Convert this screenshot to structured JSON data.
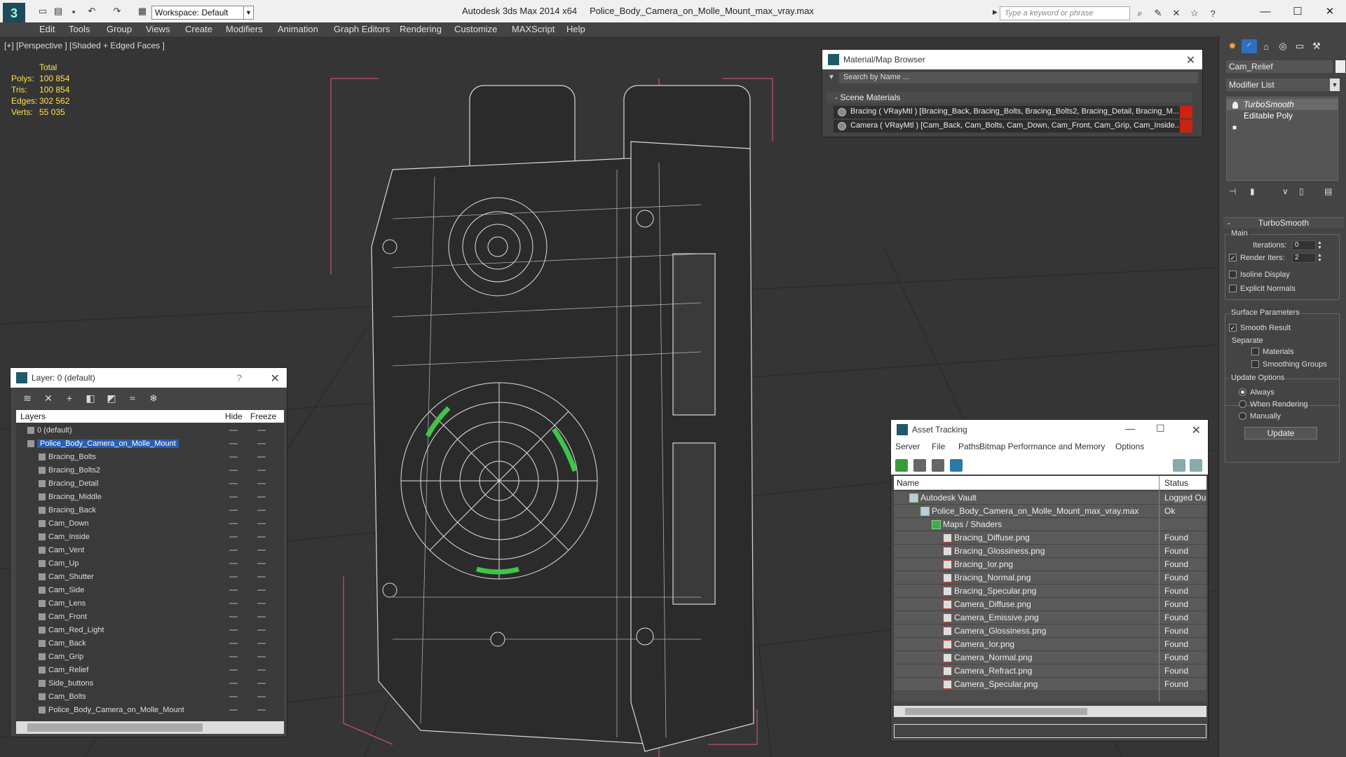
{
  "titlebar": {
    "workspace": "Workspace: Default",
    "app_title": "Autodesk 3ds Max  2014 x64",
    "file_name": "Police_Body_Camera_on_Molle_Mount_max_vray.max",
    "search_placeholder": "Type a keyword or phrase"
  },
  "menu": [
    "Edit",
    "Tools",
    "Group",
    "Views",
    "Create",
    "Modifiers",
    "Animation",
    "Graph Editors",
    "Rendering",
    "Customize",
    "MAXScript",
    "Help"
  ],
  "viewport": {
    "label": "[+] [Perspective ] [Shaded + Edged Faces ]",
    "stats": {
      "header": "Total",
      "rows": [
        {
          "k": "Polys:",
          "v": "100 854"
        },
        {
          "k": "Tris:",
          "v": "100 854"
        },
        {
          "k": "Edges:",
          "v": "302 562"
        },
        {
          "k": "Verts:",
          "v": "55 035"
        }
      ]
    }
  },
  "material_browser": {
    "title": "Material/Map Browser",
    "search": "Search by Name ...",
    "section": "Scene Materials",
    "rows": [
      "Bracing  ( VRayMtl )  [Bracing_Back, Bracing_Bolts, Bracing_Bolts2, Bracing_Detail, Bracing_M...",
      "Camera  ( VRayMtl )  [Cam_Back, Cam_Bolts, Cam_Down, Cam_Front, Cam_Grip, Cam_Inside..."
    ]
  },
  "layers": {
    "title": "Layer: 0 (default)",
    "help": "?",
    "col_layers": "Layers",
    "col_hide": "Hide",
    "col_freeze": "Freeze",
    "items": [
      "0 (default)",
      "Police_Body_Camera_on_Molle_Mount",
      "Bracing_Bolts",
      "Bracing_Bolts2",
      "Bracing_Detail",
      "Bracing_Middle",
      "Bracing_Back",
      "Cam_Down",
      "Cam_Inside",
      "Cam_Vent",
      "Cam_Up",
      "Cam_Shutter",
      "Cam_Side",
      "Cam_Lens",
      "Cam_Front",
      "Cam_Red_Light",
      "Cam_Back",
      "Cam_Grip",
      "Cam_Relief",
      "Side_buttons",
      "Cam_Bolts",
      "Police_Body_Camera_on_Molle_Mount"
    ]
  },
  "asset_tracking": {
    "title": "Asset Tracking",
    "menus": [
      "Server",
      "File",
      "Paths",
      "Bitmap Performance and Memory",
      "Options"
    ],
    "col_name": "Name",
    "col_status": "Status",
    "rows": [
      {
        "name": "Autodesk Vault",
        "status": "Logged Ou"
      },
      {
        "name": "Police_Body_Camera_on_Molle_Mount_max_vray.max",
        "status": "Ok"
      },
      {
        "name": "Maps / Shaders",
        "status": ""
      },
      {
        "name": "Bracing_Diffuse.png",
        "status": "Found"
      },
      {
        "name": "Bracing_Glossiness.png",
        "status": "Found"
      },
      {
        "name": "Bracing_Ior.png",
        "status": "Found"
      },
      {
        "name": "Bracing_Normal.png",
        "status": "Found"
      },
      {
        "name": "Bracing_Specular.png",
        "status": "Found"
      },
      {
        "name": "Camera_Diffuse.png",
        "status": "Found"
      },
      {
        "name": "Camera_Emissive.png",
        "status": "Found"
      },
      {
        "name": "Camera_Glossiness.png",
        "status": "Found"
      },
      {
        "name": "Camera_Ior.png",
        "status": "Found"
      },
      {
        "name": "Camera_Normal.png",
        "status": "Found"
      },
      {
        "name": "Camera_Refract.png",
        "status": "Found"
      },
      {
        "name": "Camera_Specular.png",
        "status": "Found"
      }
    ]
  },
  "command_panel": {
    "object_name": "Cam_Relief",
    "modifier_list": "Modifier List",
    "stack": [
      "TurboSmooth",
      "Editable Poly"
    ],
    "rollout": "TurboSmooth",
    "main_group": "Main",
    "iterations_label": "Iterations:",
    "iterations_value": "0",
    "render_iters_label": "Render Iters:",
    "render_iters_value": "2",
    "isoline": "Isoline Display",
    "explicit_normals": "Explicit Normals",
    "surface_group": "Surface Parameters",
    "smooth_result": "Smooth Result",
    "separate": "Separate",
    "materials": "Materials",
    "smoothing_groups": "Smoothing Groups",
    "update_group": "Update Options",
    "always": "Always",
    "when_rendering": "When Rendering",
    "manually": "Manually",
    "update_btn": "Update"
  }
}
